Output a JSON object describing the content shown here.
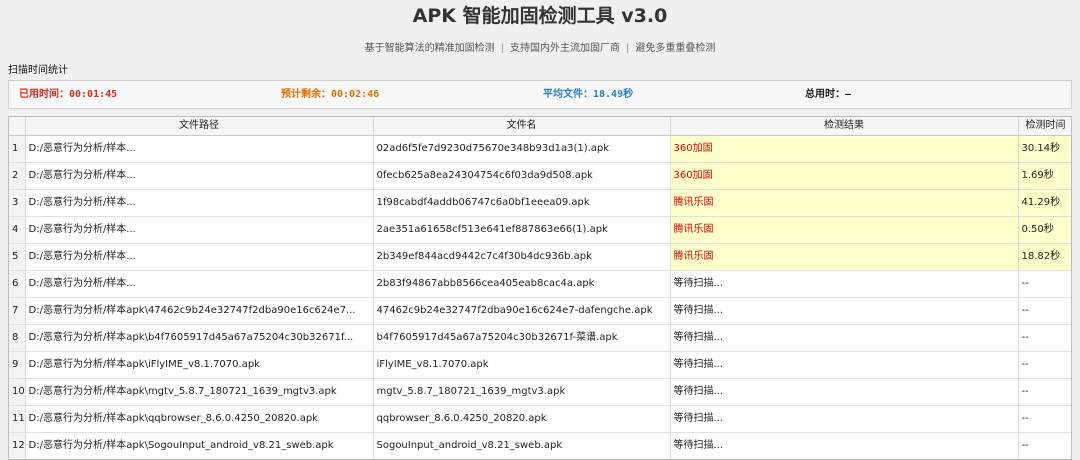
{
  "header": {
    "title": "APK 智能加固检测工具 v3.0",
    "subtitle_parts": [
      "基于智能算法的精准加固检测",
      "支持国内外主流加固厂商",
      "避免多重重叠检测"
    ],
    "separator": "|"
  },
  "stats_section": {
    "label": "扫描时间统计",
    "used": {
      "label": "已用时间：",
      "value": "00:01:45",
      "color": "#d62e1f"
    },
    "remaining": {
      "label": "预计剩余：",
      "value": "00:02:46",
      "color": "#e07000"
    },
    "average": {
      "label": "平均文件：",
      "value": "18.49秒",
      "color": "#2a7fc9"
    },
    "total": {
      "label": "总用时：",
      "value": "—",
      "color": "#222222"
    }
  },
  "table": {
    "columns": [
      "文件路径",
      "文件名",
      "检测结果",
      "检测时间"
    ],
    "highlight_color": "#ffffcc",
    "rows": [
      {
        "idx": "1",
        "path": "D:/恶意行为分析/样本...",
        "name": "02ad6f5fe7d9230d75670e348b93d1a3(1).apk",
        "result": "360加固",
        "time": "30.14秒",
        "done": true
      },
      {
        "idx": "2",
        "path": "D:/恶意行为分析/样本...",
        "name": "0fecb625a8ea24304754c6f03da9d508.apk",
        "result": "360加固",
        "time": "1.69秒",
        "done": true
      },
      {
        "idx": "3",
        "path": "D:/恶意行为分析/样本...",
        "name": "1f98cabdf4addb06747c6a0bf1eeea09.apk",
        "result": "腾讯乐固",
        "time": "41.29秒",
        "done": true
      },
      {
        "idx": "4",
        "path": "D:/恶意行为分析/样本...",
        "name": "2ae351a61658cf513e641ef887863e66(1).apk",
        "result": "腾讯乐固",
        "time": "0.50秒",
        "done": true
      },
      {
        "idx": "5",
        "path": "D:/恶意行为分析/样本...",
        "name": "2b349ef844acd9442c7c4f30b4dc936b.apk",
        "result": "腾讯乐固",
        "time": "18.82秒",
        "done": true
      },
      {
        "idx": "6",
        "path": "D:/恶意行为分析/样本...",
        "name": "2b83f94867abb8566cea405eab8cac4a.apk",
        "result": "等待扫描...",
        "time": "--",
        "done": false
      },
      {
        "idx": "7",
        "path": "D:/恶意行为分析/样本apk\\47462c9b24e32747f2dba90e16c624e7...",
        "name": "47462c9b24e32747f2dba90e16c624e7-dafengche.apk",
        "result": "等待扫描...",
        "time": "--",
        "done": false
      },
      {
        "idx": "8",
        "path": "D:/恶意行为分析/样本apk\\b4f7605917d45a67a75204c30b32671f...",
        "name": "b4f7605917d45a67a75204c30b32671f-菜谱.apk",
        "result": "等待扫描...",
        "time": "--",
        "done": false
      },
      {
        "idx": "9",
        "path": "D:/恶意行为分析/样本apk\\iFlyIME_v8.1.7070.apk",
        "name": "iFlyIME_v8.1.7070.apk",
        "result": "等待扫描...",
        "time": "--",
        "done": false
      },
      {
        "idx": "10",
        "path": "D:/恶意行为分析/样本apk\\mgtv_5.8.7_180721_1639_mgtv3.apk",
        "name": "mgtv_5.8.7_180721_1639_mgtv3.apk",
        "result": "等待扫描...",
        "time": "--",
        "done": false
      },
      {
        "idx": "11",
        "path": "D:/恶意行为分析/样本apk\\qqbrowser_8.6.0.4250_20820.apk",
        "name": "qqbrowser_8.6.0.4250_20820.apk",
        "result": "等待扫描...",
        "time": "--",
        "done": false
      },
      {
        "idx": "12",
        "path": "D:/恶意行为分析/样本apk\\SogouInput_android_v8.21_sweb.apk",
        "name": "SogouInput_android_v8.21_sweb.apk",
        "result": "等待扫描...",
        "time": "--",
        "done": false
      }
    ]
  }
}
